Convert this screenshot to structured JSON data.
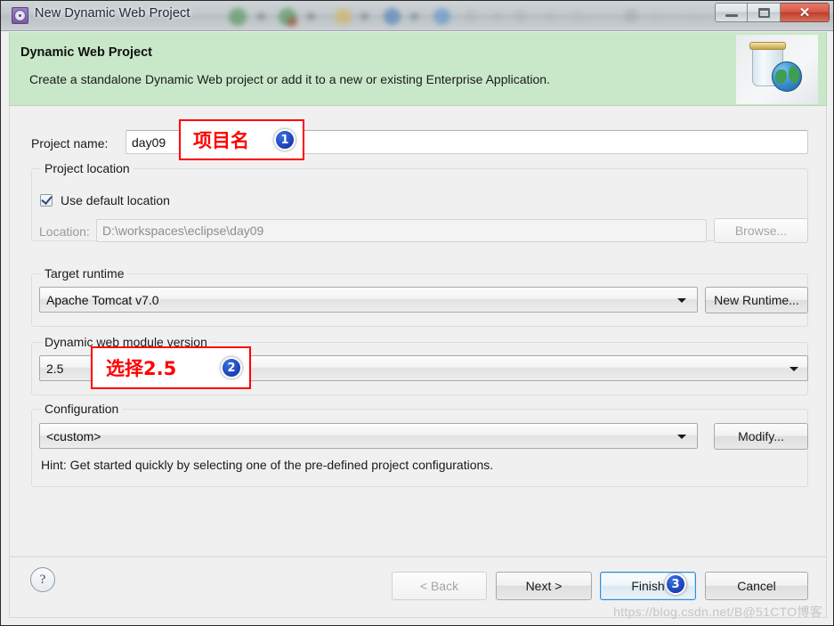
{
  "window": {
    "title": "New Dynamic Web Project",
    "icon": "gear-icon",
    "controls": {
      "minimize": "–",
      "maximize": "□",
      "close": "✕"
    }
  },
  "banner": {
    "title": "Dynamic Web Project",
    "description": "Create a standalone Dynamic Web project or add it to a new or existing Enterprise Application.",
    "icon": "jar-globe-icon",
    "background_color": "#c9e8c9"
  },
  "form": {
    "project_name": {
      "label": "Project name:",
      "value": "day09"
    },
    "project_location": {
      "group_title": "Project location",
      "use_default_label": "Use default location",
      "use_default_checked": true,
      "location_label": "Location:",
      "location_value": "D:\\workspaces\\eclipse\\day09",
      "browse_label": "Browse...",
      "browse_enabled": false
    },
    "target_runtime": {
      "group_title": "Target runtime",
      "value": "Apache Tomcat v7.0",
      "new_runtime_label": "New Runtime..."
    },
    "module_version": {
      "group_title": "Dynamic web module version",
      "value": "2.5"
    },
    "configuration": {
      "group_title": "Configuration",
      "value": "<custom>",
      "modify_label": "Modify...",
      "hint": "Hint: Get started quickly by selecting one of the pre-defined project configurations."
    }
  },
  "footer": {
    "help_label": "?",
    "buttons": [
      {
        "label": "< Back",
        "enabled": false,
        "default": false
      },
      {
        "label": "Next >",
        "enabled": true,
        "default": false
      },
      {
        "label": "Finish",
        "enabled": true,
        "default": true
      },
      {
        "label": "Cancel",
        "enabled": true,
        "default": false
      }
    ]
  },
  "annotations": {
    "accent_color": "#ff0000",
    "badge_color": "#1b3fb5",
    "items": [
      {
        "text": "项目名",
        "number": "1"
      },
      {
        "text": "选择2.5",
        "number": "2"
      },
      {
        "text": "",
        "number": "3"
      }
    ]
  },
  "watermark": {
    "text": "https://blog.csdn.net/B@51CTO博客"
  }
}
